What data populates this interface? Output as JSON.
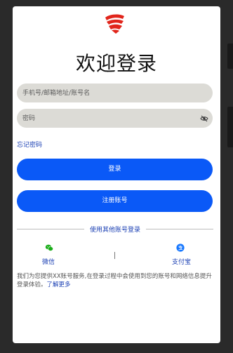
{
  "title": "欢迎登录",
  "phone_field": {
    "placeholder": "手机号/邮箱地址/账号名"
  },
  "password_field": {
    "placeholder": "密码"
  },
  "forgot_password": "忘记密码",
  "login_button": "登录",
  "register_button": "注册账号",
  "other_login_divider": "使用其他账号登录",
  "social": {
    "wechat": {
      "label": "微信",
      "icon": "wechat-icon",
      "color": "#1aad19"
    },
    "alipay": {
      "label": "支付宝",
      "icon": "alipay-icon",
      "color": "#1677ff"
    }
  },
  "disclaimer": {
    "text": "我们为您提供XX账号服务,在登录过程中会使用到您的账号和网络信息提升登录体验。",
    "link": "了解更多"
  },
  "colors": {
    "primary": "#0a59f7",
    "link": "#1a3fb3",
    "field_bg": "#dcdbd6",
    "logo": "#e1251b"
  }
}
